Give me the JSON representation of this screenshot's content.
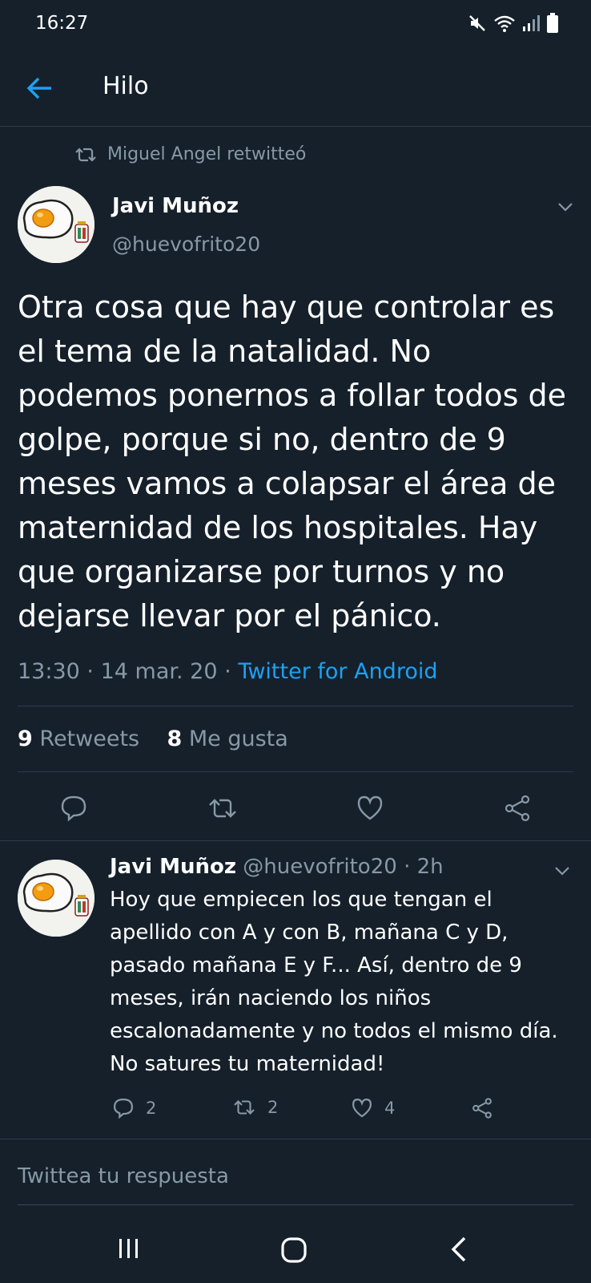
{
  "status": {
    "time": "16:27",
    "icons": [
      "mute-icon",
      "wifi-icon",
      "signal-icon",
      "battery-icon"
    ]
  },
  "header": {
    "title": "Hilo",
    "back_icon": "arrow-left-icon"
  },
  "retweet_context": {
    "text": "Miguel Angel retwitteó",
    "icon": "retweet-icon"
  },
  "tweet": {
    "author_name": "Javi Muñoz",
    "author_handle": "@huevofrito20",
    "text": "Otra cosa que hay que controlar es el tema de la natalidad. No podemos ponernos a follar todos de golpe, porque si no, dentro de 9 meses vamos a colapsar el área de maternidad de los hospitales. Hay que organizarse por turnos y no dejarse llevar por el pánico.",
    "time": "13:30",
    "separator": "·",
    "date": "14 mar. 20",
    "source": "Twitter for Android",
    "retweets_count": "9",
    "retweets_label": "Retweets",
    "likes_count": "8",
    "likes_label": "Me gusta",
    "actions": [
      "reply-icon",
      "retweet-icon",
      "like-icon",
      "share-icon"
    ]
  },
  "reply": {
    "author_name": "Javi Muñoz",
    "author_handle": "@huevofrito20",
    "age": "2h",
    "text": "Hoy que empiecen los que tengan el apellido con A y con B, mañana C y D, pasado mañana E y F... Así, dentro de 9 meses, irán naciendo los niños escalonadamente y no todos el mismo día. No satures tu maternidad!",
    "reply_count": "2",
    "retweet_count": "2",
    "like_count": "4"
  },
  "compose": {
    "placeholder": "Twittea tu respuesta"
  },
  "navbar": {
    "icons": [
      "recent-apps-icon",
      "home-icon",
      "back-icon"
    ]
  },
  "colors": {
    "background": "#15202b",
    "accent": "#1da1f2",
    "muted": "#8899a6",
    "divider": "#2f3b47"
  }
}
